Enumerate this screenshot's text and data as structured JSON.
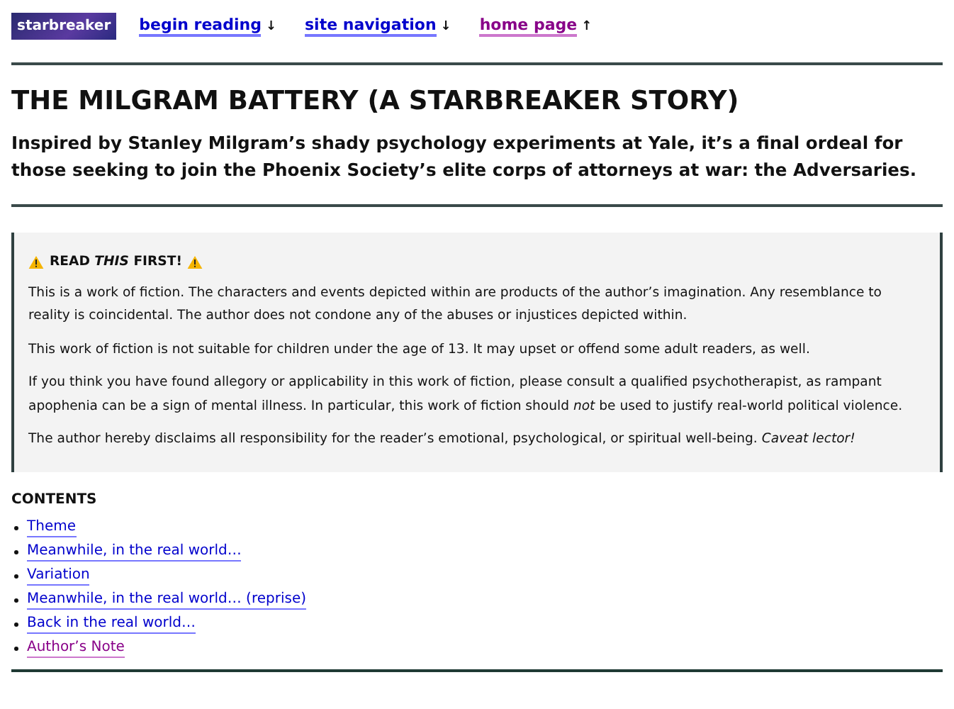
{
  "header": {
    "logo": "starbreaker",
    "links": [
      {
        "label": "begin reading",
        "arrow": "↓",
        "visited": false
      },
      {
        "label": "site navigation",
        "arrow": "↓",
        "visited": false
      },
      {
        "label": "home page",
        "arrow": "↑",
        "visited": true
      }
    ]
  },
  "title": "THE MILGRAM BATTERY (A STARBREAKER STORY)",
  "subtitle": "Inspired by Stanley Milgram’s shady psychology experiments at Yale, it’s a final ordeal for those seeking to join the Phoenix Society’s elite corps of attorneys at war: the Adversaries.",
  "notice": {
    "heading": "READ *THIS* FIRST!",
    "paragraphs": [
      "This is a work of fiction. The characters and events depicted within are products of the author’s imagination. Any resemblance to reality is coincidental. The author does not condone any of the abuses or injustices depicted within.",
      "This work of fiction is not suitable for children under the age of 13. It may upset or offend some adult readers, as well.",
      "If you think you have found allegory or applicability in this work of fiction, please consult a qualified psychotherapist, as rampant apophenia can be a sign of mental illness. In particular, this work of fiction should *not* be used to justify real-world political violence.",
      "The author hereby disclaims all responsibility for the reader’s emotional, psychological, or spiritual well-being. *Caveat lector!*"
    ]
  },
  "contents": {
    "heading": "CONTENTS",
    "items": [
      {
        "label": "Theme",
        "visited": false
      },
      {
        "label": "Meanwhile, in the real world…",
        "visited": false
      },
      {
        "label": "Variation",
        "visited": false
      },
      {
        "label": "Meanwhile, in the real world… (reprise)",
        "visited": false
      },
      {
        "label": "Back in the real world…",
        "visited": false
      },
      {
        "label": "Author’s Note",
        "visited": true
      }
    ]
  }
}
